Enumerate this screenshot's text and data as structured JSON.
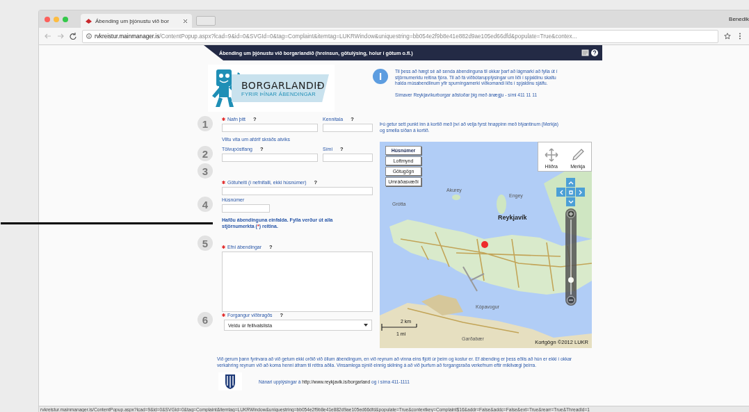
{
  "browser": {
    "tab_title": "Ábending um þjónustu við bor",
    "user": "Benedik",
    "url_host": "rvkreistur.mainmanager.is",
    "url_path": "/ContentPopup.aspx?lcad=9&id=0&SVGId=0&tag=Complaint&itemtag=LUKRWindow&uniquestring=bb054e2f9b8e41e882d9ae105ed66dfd&populate=True&contex..."
  },
  "header": {
    "title": "Ábending um þjónustu við borgarlandið (hreinsun, götulýsing, holur í götum o.fl.)"
  },
  "logo": {
    "title": "BORGARLANDIÐ",
    "subtitle": "FYRIR ÞÍNAR ÁBENDINGAR"
  },
  "info": {
    "paragraphs": [
      "Til þess að hægt sé að senda ábendinguna til okkar þarf að lágmarki að fylla út í stjörnumerktu reitina fjóra. Til að fá viðbótarupplýsingar um liði í spjaldinu skaltu halda músabendlinum yfir spurningamerki viðkomandi liðs í spjaldinu sjálfu.",
      "Símaver Reykjavíkurborgar aðstoðar þig með ánægju - sími 411 11 11"
    ]
  },
  "form_items": [
    {
      "kind": "step",
      "number": "1",
      "rows": [
        [
          {
            "label": "Nafn þitt",
            "required": true,
            "help": "?",
            "kind": "text"
          },
          {
            "label": "Kennitala",
            "required": false,
            "help": "?",
            "kind": "narrow"
          }
        ]
      ],
      "link": "Viltu vita um afdrif skráðs atviks"
    },
    {
      "kind": "step",
      "number": "2",
      "rows": [
        [
          {
            "label": "Tölvupóstfang",
            "required": false,
            "help": "?",
            "kind": "text"
          },
          {
            "label": "Sími",
            "required": false,
            "help": "?",
            "kind": "narrow"
          }
        ]
      ]
    },
    {
      "kind": "step",
      "number": "3",
      "rows": [
        [
          {
            "label": "Götuheiti (í nefnifalli, ekki húsnúmer)",
            "required": true,
            "help": "?",
            "kind": "wide"
          }
        ]
      ]
    },
    {
      "kind": "step",
      "number": "4",
      "rows": [
        [
          {
            "label": "Húsnúmer",
            "required": false,
            "kind": "short"
          }
        ]
      ]
    },
    {
      "kind": "notice",
      "before": "Hafðu ábendinguna einfalda. Fylla verður út alla stjörnumerkta (",
      "mark": "*",
      "after": ") reitina."
    },
    {
      "kind": "step",
      "number": "5",
      "rows": [
        [
          {
            "label": "Efni ábendingar",
            "required": true,
            "help": "?",
            "kind": "textarea"
          }
        ]
      ]
    },
    {
      "kind": "step",
      "number": "6",
      "rows": [
        [
          {
            "label": "Forgangur viðbragðs",
            "required": true,
            "help": "?",
            "kind": "select",
            "value": "Veldu úr fellivalslista"
          }
        ]
      ]
    }
  ],
  "map": {
    "hint": "Þú getur sett punkt inn á kortið með því að velja fyrst hnappinn með blýantinum (Merkja) og smella síðan á kortið.",
    "layers": [
      {
        "label": "Húsnúmer",
        "selected": true
      },
      {
        "label": "Loftmynd",
        "selected": false
      },
      {
        "label": "Götugögn",
        "selected": false
      },
      {
        "label": "Umráðasvæði",
        "selected": false
      }
    ],
    "tools": [
      {
        "label": "Hliðra",
        "kind": "pan"
      },
      {
        "label": "Merkja",
        "kind": "pencil"
      }
    ],
    "zoom": {
      "level": 0.2
    },
    "city_label": "Reykjavík",
    "places": [
      {
        "label": "Grótta"
      },
      {
        "label": "Akurey"
      },
      {
        "label": "Engey"
      },
      {
        "label": "Kópavogur"
      },
      {
        "label": "Garðabær"
      }
    ],
    "scale_km": "2 km",
    "scale_mi": "1 mi",
    "attribution": "Kortgögn ©2012 LUKR"
  },
  "disclaimer": "Við gerum þann fyrirvara að við getum ekki orðið við öllum ábendingum, en við reynum að vinna eins fljótt úr þeim og kostur er. Ef ábending er þess eðlis að hún er ekki í okkar verkahring reynum við að koma henni áfram til réttra aðila. Vinsamlega sýnið einnig skilning á að við þurfum að forgangsraða verkefnum eftir mikilvægi þeirra.",
  "contact": {
    "before": "Nánari upplýsingar á ",
    "link": "http://www.reykjavik.is/borgarland",
    "after": " og í síma 411-1111"
  },
  "status_url": "rvkreistur.mainmanager.is/ContentPopup.aspx?lcad=9&id=0&SVGId=0&tag=Complaint&itemtag=LUKRWindow&uniquestring=bb054e2f9b8e41e882d9ae105ed66dfd&populate=True&contextkey=Complaint$16&addr=False&addc=False&ext=True&rearr=True&ThreadId=1"
}
